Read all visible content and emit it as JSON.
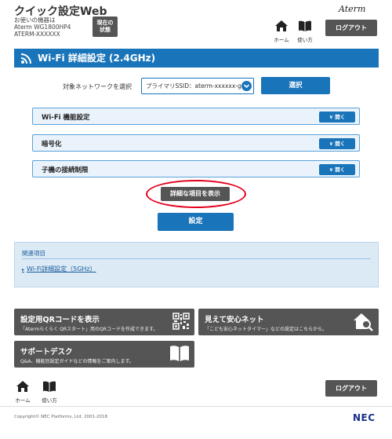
{
  "header": {
    "app_title": "クイック設定Web",
    "device_info": [
      "お使いの機器は",
      "Aterm WG1800HP4",
      "ATERM-XXXXXX"
    ],
    "status_button": [
      "現在の",
      "状態"
    ],
    "brand": "Aterm",
    "home_label": "ホーム",
    "manual_label": "使い方",
    "logout_label": "ログアウト"
  },
  "page": {
    "title": "Wi-Fi 詳細設定 (2.4GHz)"
  },
  "network": {
    "label": "対象ネットワークを選択",
    "selected": "プライマリSSID：aterm-xxxxxx-g",
    "select_button": "選択"
  },
  "sections": [
    {
      "label": "Wi-Fi 機能設定",
      "open_label": "開く"
    },
    {
      "label": "暗号化",
      "open_label": "開く"
    },
    {
      "label": "子機の接続制限",
      "open_label": "開く"
    }
  ],
  "detail_button": "詳細な項目を表示",
  "submit_button": "設定",
  "related": {
    "heading": "関連項目",
    "link": "Wi-Fi詳細設定（5GHz）"
  },
  "tiles": [
    {
      "title": "設定用QRコードを表示",
      "desc": "「Atermらくらく QRスタート」用のQRコードを作成できます。",
      "icon": "qr-code-icon"
    },
    {
      "title": "見えて安心ネット",
      "desc": "「こども安心ネットタイマー」などの設定はこちらから。",
      "icon": "house-search-icon"
    },
    {
      "title": "サポートデスク",
      "desc": "Q&A、機能別設定ガイドなどの情報をご案内します。",
      "icon": "book-icon"
    }
  ],
  "footer": {
    "home_label": "ホーム",
    "manual_label": "使い方",
    "logout_label": "ログアウト",
    "copyright": "Copyright© NEC Platforms, Ltd. 2001-2018",
    "logo": "NEC"
  },
  "colors": {
    "accent": "#1a74ba",
    "dark_button": "#555555",
    "highlight": "#e3001b"
  }
}
